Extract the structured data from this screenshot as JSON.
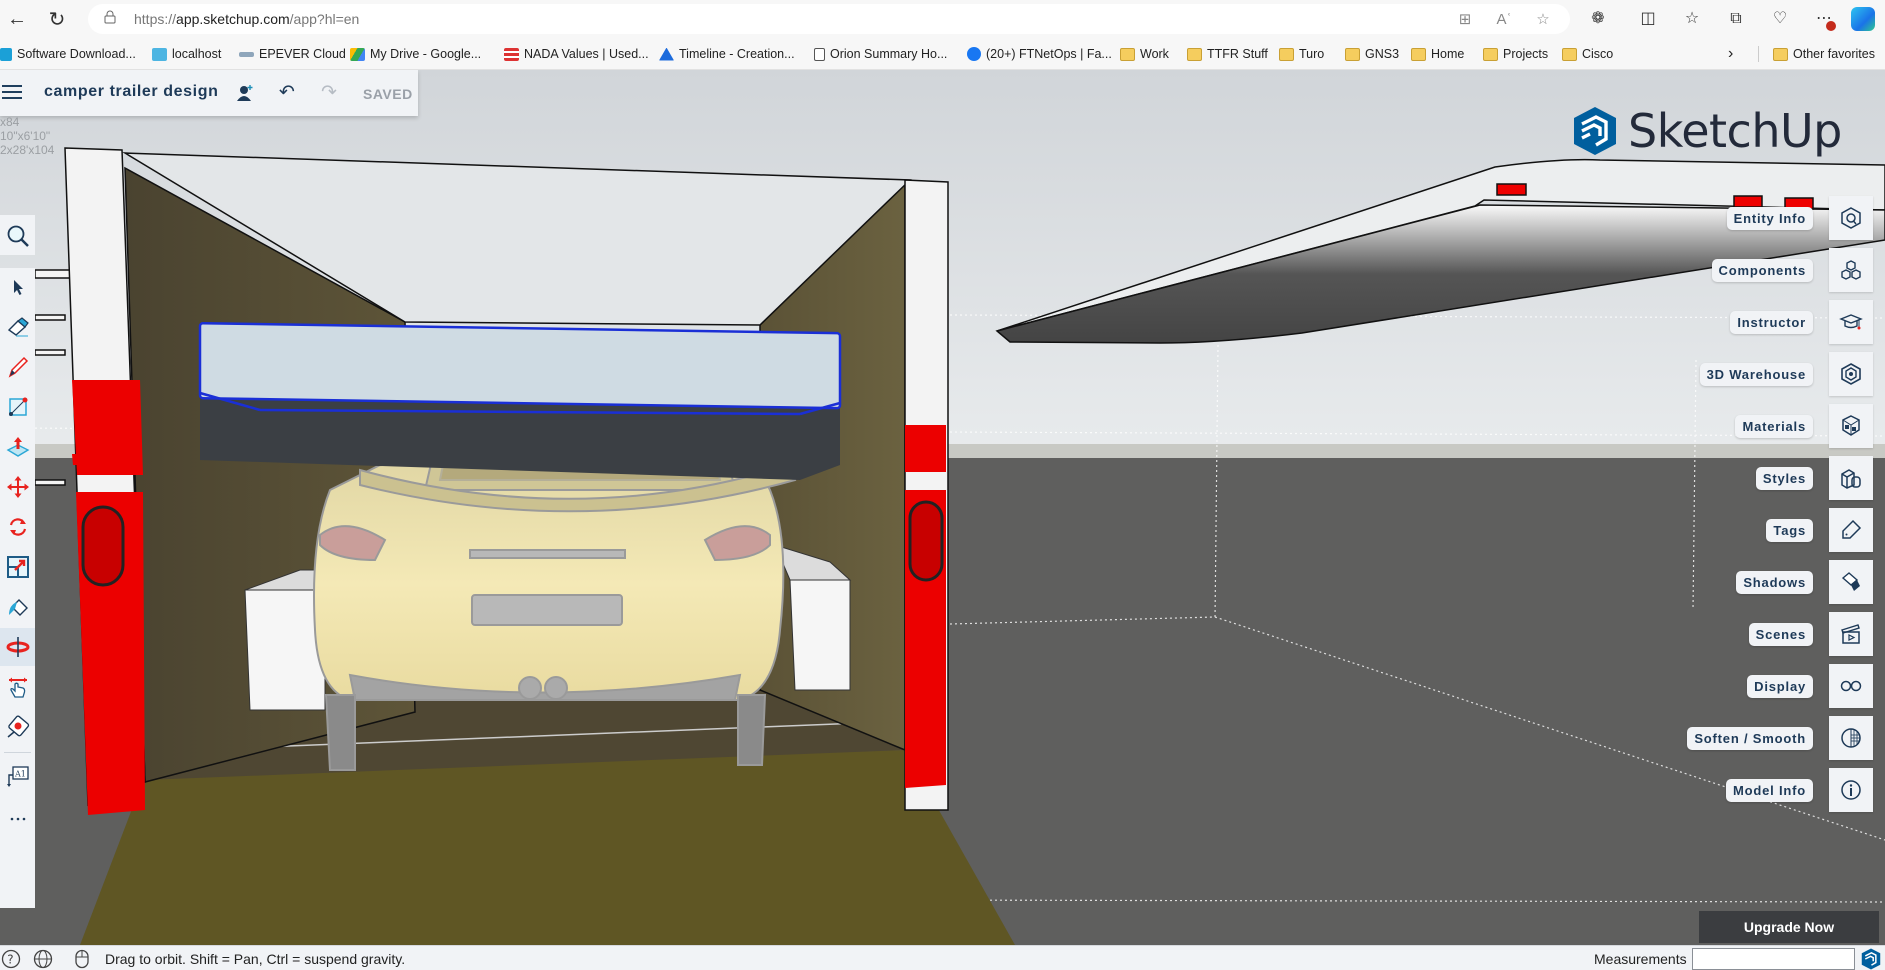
{
  "browser": {
    "url_prefix": "https://",
    "url_host": "app.sketchup.com",
    "url_path": "/app?hl=en",
    "icons": [
      "back-icon",
      "refresh-icon",
      "lock-icon",
      "app-available-icon",
      "read-aloud-icon",
      "favorite-star-icon",
      "extensions-icon",
      "split-screen-icon",
      "favorites-icon",
      "collections-icon",
      "browser-essentials-icon",
      "more-icon",
      "copilot-icon"
    ],
    "bookmarks": [
      {
        "label": "Software Download...",
        "icon": "cisco-icon"
      },
      {
        "label": "localhost",
        "icon": "site-icon"
      },
      {
        "label": "EPEVER Cloud",
        "icon": "epever-icon"
      },
      {
        "label": "My Drive - Google...",
        "icon": "google-drive-icon"
      },
      {
        "label": "NADA Values | Used...",
        "icon": "nada-icon"
      },
      {
        "label": "Timeline - Creation...",
        "icon": "atlassian-icon"
      },
      {
        "label": "Orion Summary Ho...",
        "icon": "page-icon"
      },
      {
        "label": "(20+) FTNetOps | Fa...",
        "icon": "facebook-icon"
      },
      {
        "label": "Work",
        "icon": "folder-icon"
      },
      {
        "label": "TTFR Stuff",
        "icon": "folder-icon"
      },
      {
        "label": "Turo",
        "icon": "folder-icon"
      },
      {
        "label": "GNS3",
        "icon": "folder-icon"
      },
      {
        "label": "Home",
        "icon": "folder-icon"
      },
      {
        "label": "Projects",
        "icon": "folder-icon"
      },
      {
        "label": "Cisco",
        "icon": "folder-icon"
      }
    ],
    "other_favorites": "Other favorites"
  },
  "app": {
    "file_title": "camper trailer design",
    "save_status": "SAVED",
    "logo_text": "SketchUp",
    "overlay_notes": [
      "x84",
      "10\"x6'10\"",
      "2x28'x104"
    ],
    "upgrade_label": "Upgrade Now",
    "colors": {
      "brand_blue": "#005f9e",
      "panel_text": "#1e3a58",
      "tool_red": "#e8231f"
    }
  },
  "left_toolbar": [
    {
      "name": "select",
      "icon": "select-arrow-icon"
    },
    {
      "name": "eraser",
      "icon": "eraser-icon"
    },
    {
      "name": "line",
      "icon": "pencil-icon"
    },
    {
      "name": "rectangle",
      "icon": "rectangle-icon"
    },
    {
      "name": "push-pull",
      "icon": "push-pull-icon"
    },
    {
      "name": "move",
      "icon": "move-icon"
    },
    {
      "name": "rotate",
      "icon": "rotate-icon"
    },
    {
      "name": "scale",
      "icon": "scale-icon"
    },
    {
      "name": "paint-bucket",
      "icon": "paint-bucket-icon"
    },
    {
      "name": "orbit",
      "icon": "orbit-icon",
      "active": true
    },
    {
      "name": "pan",
      "icon": "pan-hand-icon"
    },
    {
      "name": "tape-measure",
      "icon": "tape-measure-icon"
    },
    {
      "name": "text",
      "icon": "text-tool-icon"
    },
    {
      "name": "more",
      "icon": "more-icon"
    }
  ],
  "right_panel": [
    {
      "label": "Entity Info",
      "icon": "entity-info-icon"
    },
    {
      "label": "Components",
      "icon": "components-icon"
    },
    {
      "label": "Instructor",
      "icon": "instructor-icon"
    },
    {
      "label": "3D Warehouse",
      "icon": "warehouse-icon"
    },
    {
      "label": "Materials",
      "icon": "materials-icon"
    },
    {
      "label": "Styles",
      "icon": "styles-icon"
    },
    {
      "label": "Tags",
      "icon": "tag-icon"
    },
    {
      "label": "Shadows",
      "icon": "shadows-icon"
    },
    {
      "label": "Scenes",
      "icon": "scenes-icon"
    },
    {
      "label": "Display",
      "icon": "glasses-icon"
    },
    {
      "label": "Soften / Smooth",
      "icon": "soften-icon"
    },
    {
      "label": "Model Info",
      "icon": "info-icon"
    }
  ],
  "statusbar": {
    "hint": "Drag to orbit. Shift = Pan, Ctrl = suspend gravity.",
    "measurements_label": "Measurements",
    "measurements_value": ""
  }
}
